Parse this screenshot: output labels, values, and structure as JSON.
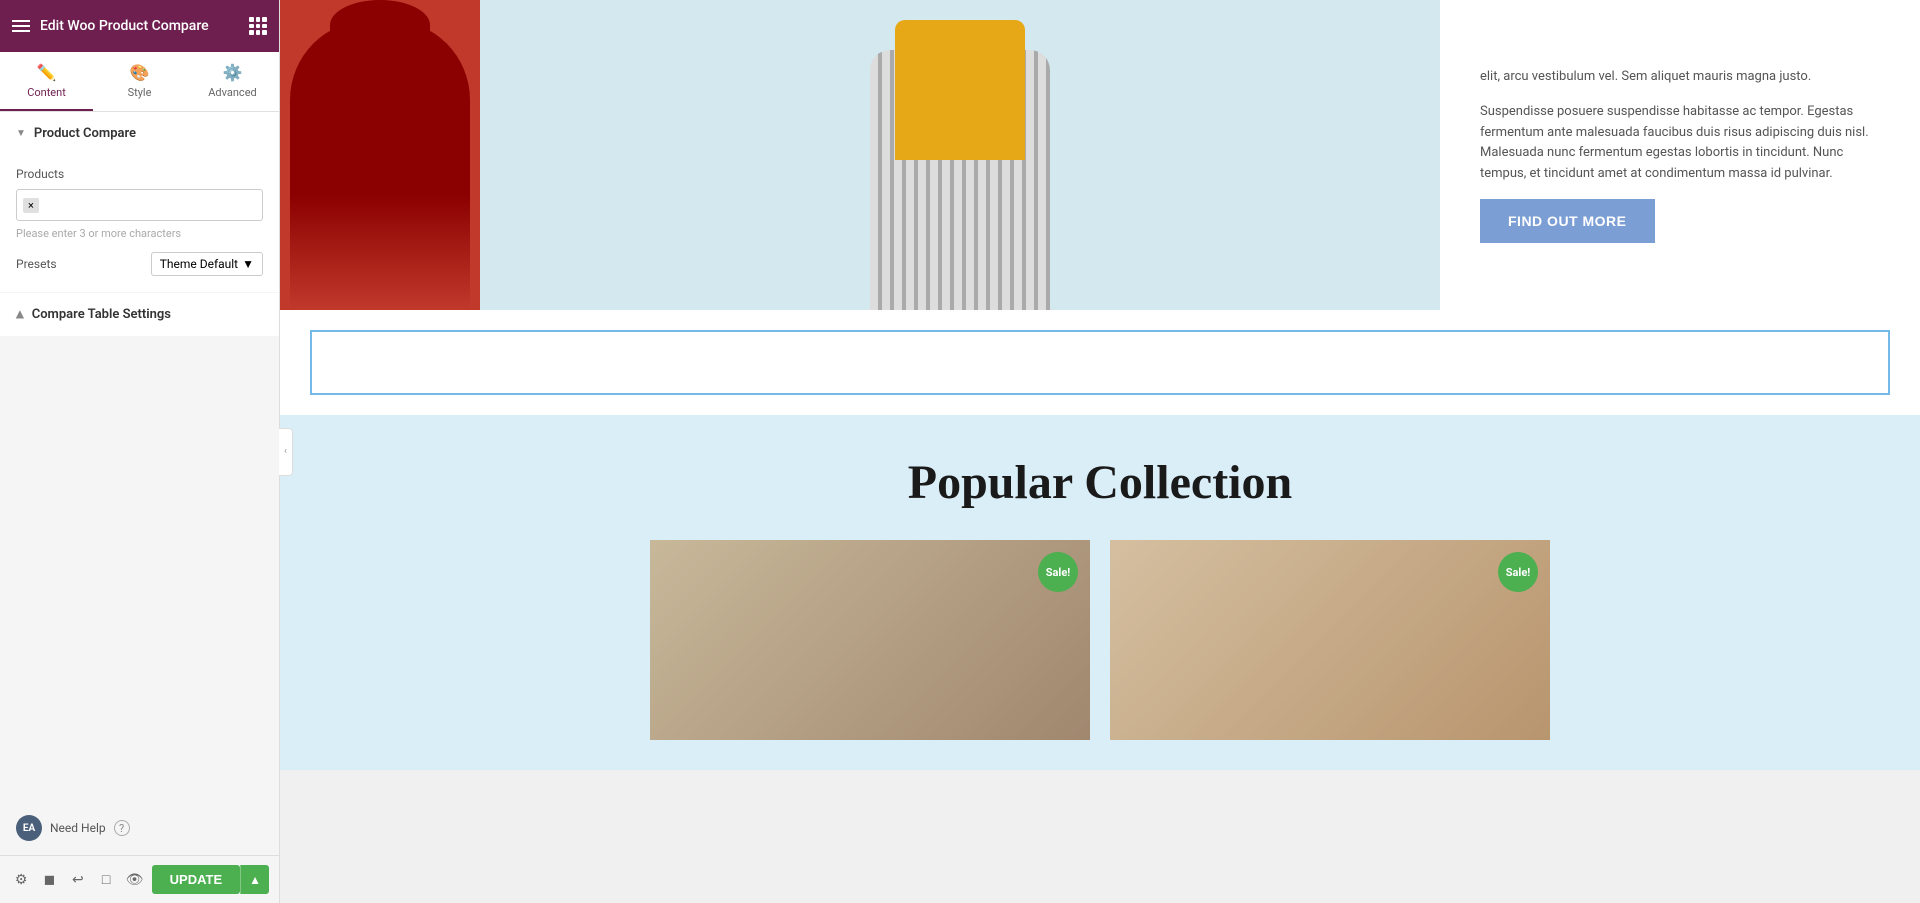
{
  "header": {
    "title": "Edit Woo Product Compare",
    "menu_icon": "menu-icon",
    "grid_icon": "grid-icon"
  },
  "tabs": [
    {
      "id": "content",
      "label": "Content",
      "icon": "✏️",
      "active": true
    },
    {
      "id": "style",
      "label": "Style",
      "icon": "🎨",
      "active": false
    },
    {
      "id": "advanced",
      "label": "Advanced",
      "icon": "⚙️",
      "active": false
    }
  ],
  "sections": {
    "product_compare": {
      "label": "Product Compare",
      "expanded": true,
      "fields": {
        "products": {
          "label": "Products",
          "tag_x": "×",
          "placeholder": "Please enter 3 or more characters",
          "presets_label": "Presets",
          "presets_default": "Theme Default",
          "presets_icon": "▼"
        }
      }
    },
    "compare_table_settings": {
      "label": "Compare Table Settings",
      "expanded": false
    }
  },
  "need_help": {
    "badge": "EA",
    "label": "Need Help",
    "help_icon": "?"
  },
  "bottom_bar": {
    "icons": [
      "⚙",
      "◼",
      "↩",
      "□",
      "👁"
    ],
    "update_label": "UPDATE",
    "update_arrow": "▲"
  },
  "collapse_handle": "‹",
  "canvas": {
    "hero_text_1": "elit, arcu vestibulum vel. Sem aliquet mauris magna justo.",
    "hero_text_2": "Suspendisse posuere suspendisse habitasse ac tempor. Egestas fermentum ante malesuada faucibus duis risus adipiscing duis nisl. Malesuada nunc fermentum egestas lobortis in tincidunt. Nunc tempus, et tincidunt amet at condimentum massa id pulvinar.",
    "find_out_more": "FIND OUT MORE",
    "popular_title": "Popular Collection",
    "sale_badge": "Sale!"
  }
}
